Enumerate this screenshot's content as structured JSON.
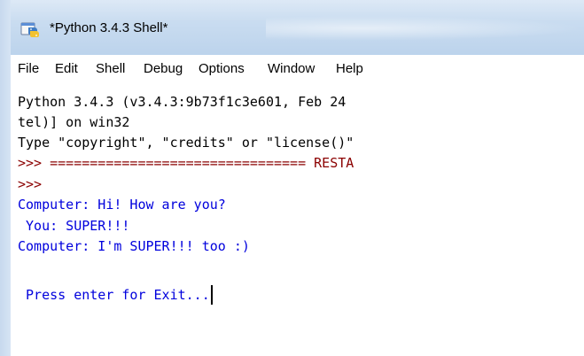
{
  "window": {
    "title": "*Python 3.4.3 Shell*",
    "icon": "python-idle-icon"
  },
  "menu": [
    "File",
    "Edit",
    "Shell",
    "Debug",
    "Options",
    "Window",
    "Help"
  ],
  "shell": {
    "lines": [
      "Python 3.4.3 (v3.4.3:9b73f1c3e601, Feb 24",
      "tel)] on win32",
      "Type \"copyright\", \"credits\" or \"license()\"",
      ">>> ================================ RESTA",
      ">>>",
      "Computer: Hi! How are you?",
      " You: SUPER!!!",
      "Computer: I'm SUPER!!! too :)",
      "",
      " Press enter for Exit..."
    ]
  },
  "colors": {
    "stdout": "#0000dd",
    "prompt": "#8b0000",
    "default": "#000000",
    "titlebar": "#c9dcf0"
  }
}
